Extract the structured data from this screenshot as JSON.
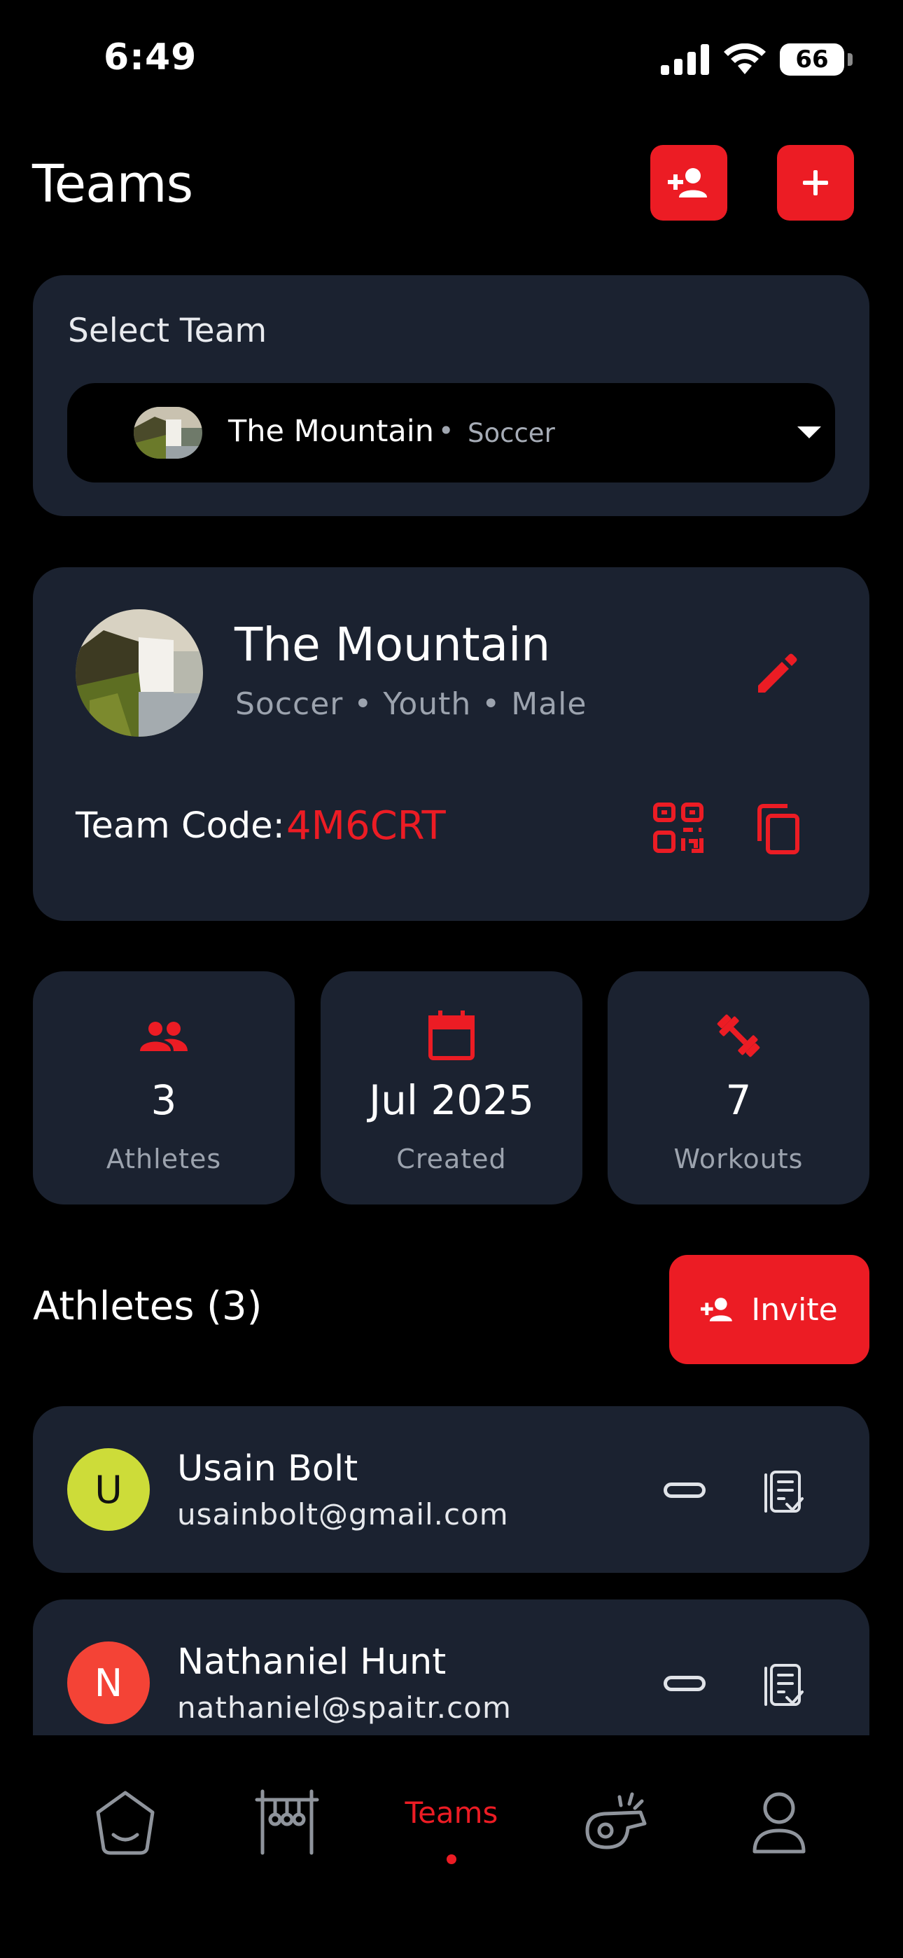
{
  "status_bar": {
    "time": "6:49",
    "battery": "66"
  },
  "header": {
    "title": "Teams"
  },
  "select_team": {
    "label": "Select Team",
    "team_name": "The Mountain",
    "separator": "•",
    "sport": "Soccer"
  },
  "team": {
    "name": "The Mountain",
    "meta": "Soccer • Youth • Male",
    "code_label": "Team Code:",
    "code": "4M6CRT"
  },
  "stats": [
    {
      "value": "3",
      "label": "Athletes",
      "icon": "people-icon"
    },
    {
      "value": "Jul 2025",
      "label": "Created",
      "icon": "calendar-icon"
    },
    {
      "value": "7",
      "label": "Workouts",
      "icon": "dumbbell-icon"
    }
  ],
  "athletes_section": {
    "title": "Athletes (3)",
    "invite_label": "Invite"
  },
  "athletes": [
    {
      "initial": "U",
      "name": "Usain Bolt",
      "email": "usainbolt@gmail.com",
      "avatar_color": "#cddc39",
      "initial_color": "#111111"
    },
    {
      "initial": "N",
      "name": "Nathaniel Hunt",
      "email": "nathaniel@spaitr.com",
      "avatar_color": "#f44336",
      "initial_color": "#ffffff"
    }
  ],
  "bottom_nav": {
    "items": [
      "home-icon",
      "gym-icon",
      "Teams",
      "whistle-icon",
      "profile-icon"
    ],
    "active_label": "Teams"
  },
  "colors": {
    "accent": "#ec1c24",
    "card": "#1b2230",
    "background": "#000000"
  }
}
